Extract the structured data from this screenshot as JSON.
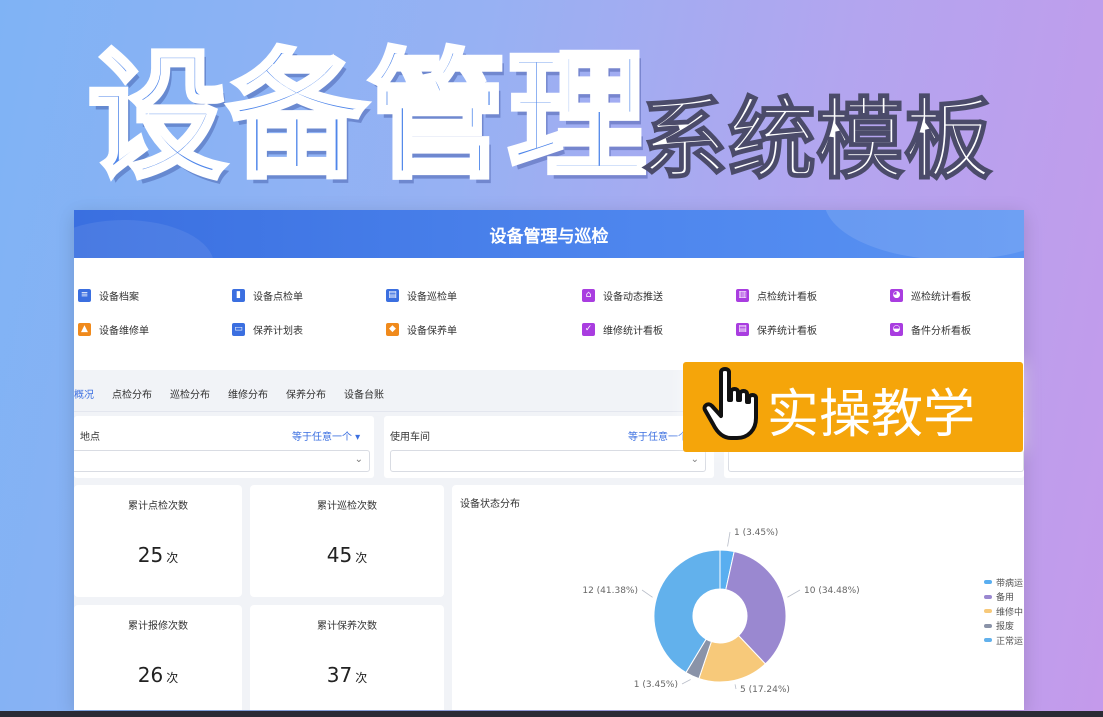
{
  "hero": {
    "title": "设备管理",
    "subtitle": "系统模板",
    "badge": "实操教学"
  },
  "app": {
    "header_title": "设备管理与巡检",
    "nav_items": [
      {
        "label": "设备档案",
        "icon": "file-list-icon",
        "color": "#3b6fe0"
      },
      {
        "label": "设备点检单",
        "icon": "bookmark-icon",
        "color": "#3b6fe0"
      },
      {
        "label": "设备巡检单",
        "icon": "clipboard-icon",
        "color": "#3b6fe0"
      },
      {
        "label": "设备动态推送",
        "icon": "home-icon",
        "color": "#a93de0"
      },
      {
        "label": "点检统计看板",
        "icon": "bar-chart-icon",
        "color": "#a93de0"
      },
      {
        "label": "巡检统计看板",
        "icon": "pie-chart-icon",
        "color": "#a93de0"
      },
      {
        "label": "设备维修单",
        "icon": "worker-icon",
        "color": "#f08a1c"
      },
      {
        "label": "保养计划表",
        "icon": "card-icon",
        "color": "#3b6fe0"
      },
      {
        "label": "设备保养单",
        "icon": "shield-icon",
        "color": "#f08a1c"
      },
      {
        "label": "维修统计看板",
        "icon": "shield-check-icon",
        "color": "#a93de0"
      },
      {
        "label": "保养统计看板",
        "icon": "clipboard-icon",
        "color": "#a93de0"
      },
      {
        "label": "备件分析看板",
        "icon": "inbox-icon",
        "color": "#a93de0"
      }
    ],
    "tabs": [
      "概况",
      "点检分布",
      "巡检分布",
      "维修分布",
      "保养分布",
      "设备台账"
    ],
    "filters": [
      {
        "label": "地点",
        "op": "等于任意一个 ▾"
      },
      {
        "label": "使用车间",
        "op": "等于任意一个 ▾"
      }
    ],
    "cards": [
      {
        "label": "累计点检次数",
        "value": "25",
        "unit": "次"
      },
      {
        "label": "累计巡检次数",
        "value": "45",
        "unit": "次"
      },
      {
        "label": "累计报修次数",
        "value": "26",
        "unit": "次"
      },
      {
        "label": "累计保养次数",
        "value": "37",
        "unit": "次"
      }
    ],
    "chart": {
      "title": "设备状态分布"
    }
  },
  "chart_data": {
    "type": "pie",
    "title": "设备状态分布",
    "donut": true,
    "slices": [
      {
        "name": "带病运行",
        "value": 1,
        "label": "1 (3.45%)",
        "color": "#59aef0"
      },
      {
        "name": "备用",
        "value": 10,
        "label": "10 (34.48%)",
        "color": "#9a88d0"
      },
      {
        "name": "维修中",
        "value": 5,
        "label": "5 (17.24%)",
        "color": "#f7c97a"
      },
      {
        "name": "报废",
        "value": 1,
        "label": "1 (3.45%)",
        "color": "#8a93a8"
      },
      {
        "name": "正常运行",
        "value": 12,
        "label": "12 (41.38%)",
        "color": "#62b1ec"
      }
    ],
    "legend": [
      "带病运",
      "备用",
      "维修中",
      "报废",
      "正常运"
    ],
    "legend_position": "right"
  }
}
